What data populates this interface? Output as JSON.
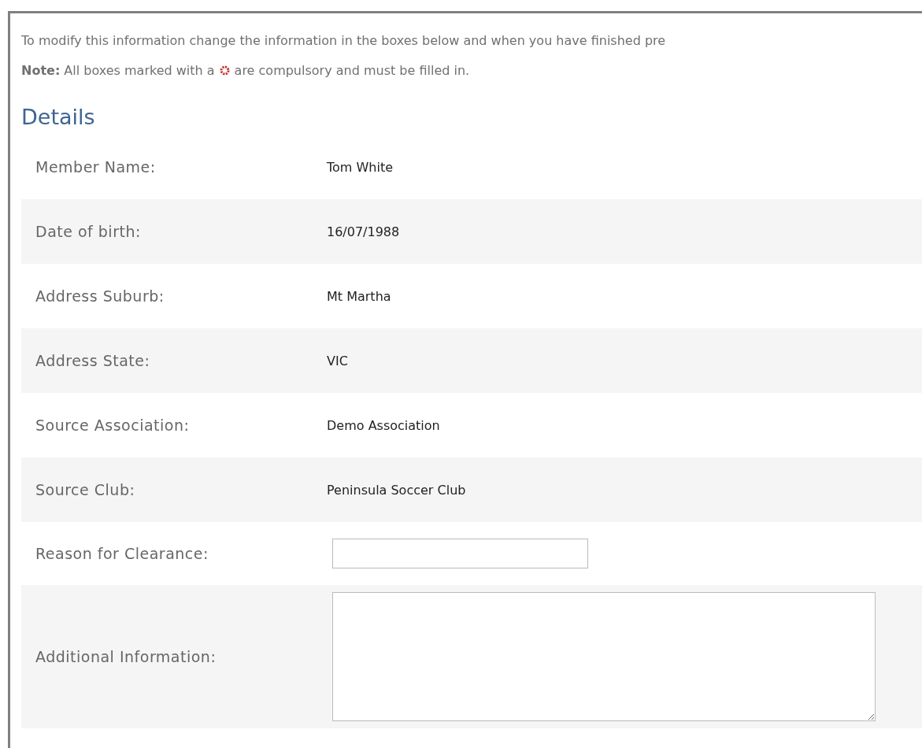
{
  "intro": "To modify this information change the information in the boxes below and when you have finished pre",
  "note": {
    "before": "**Note:** All boxes marked with a",
    "after": "are compulsory and must be filled in."
  },
  "section_title": "Details",
  "rows": [
    {
      "kind": "text",
      "label": "Member Name:",
      "value": "Tom White"
    },
    {
      "kind": "text",
      "label": "Date of birth:",
      "value": "16/07/1988"
    },
    {
      "kind": "text",
      "label": "Address Suburb:",
      "value": "Mt Martha"
    },
    {
      "kind": "text",
      "label": "Address State:",
      "value": "VIC"
    },
    {
      "kind": "text",
      "label": "Source Association:",
      "value": "Demo Association"
    },
    {
      "kind": "text",
      "label": "Source Club:",
      "value": "Peninsula Soccer Club"
    },
    {
      "kind": "input",
      "label": "Reason for Clearance:"
    },
    {
      "kind": "textarea",
      "label": "Additional Information:"
    }
  ]
}
